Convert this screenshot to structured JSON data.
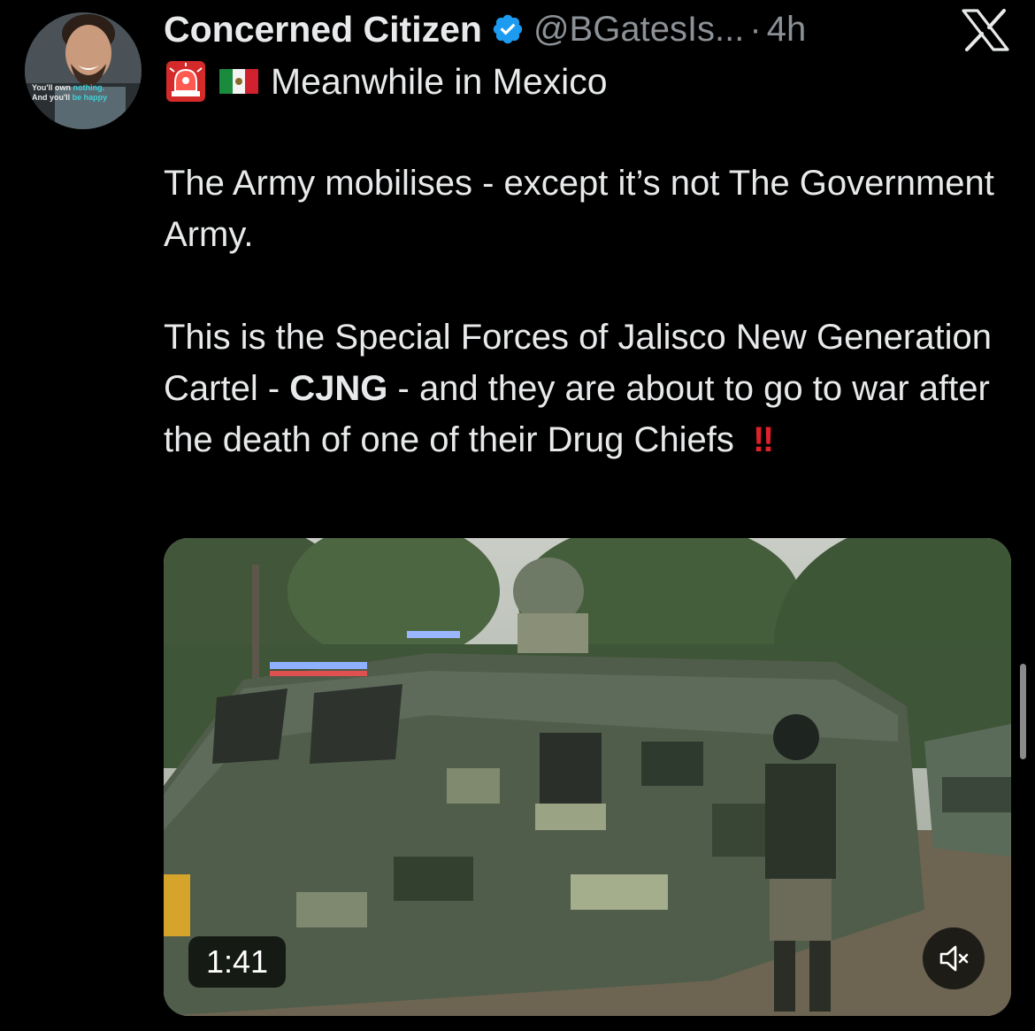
{
  "author": {
    "display_name": "Concerned Citizen",
    "handle": "@BGatesIs...",
    "separator": "·",
    "timestamp": "4h",
    "verified": true,
    "avatar": {
      "line1_a": "You'll own ",
      "line1_b": "nothing.",
      "line2_a": "And you'll ",
      "line2_b": "be happy",
      "accent_color": "#3fd2d9"
    }
  },
  "icons": {
    "verified": "verified-badge-icon",
    "platform_logo": "x-logo-icon",
    "siren": "rotating-light-icon",
    "flag": "mexico-flag-icon",
    "mute": "speaker-muted-icon",
    "exclamation": "double-exclamation-icon"
  },
  "tweet": {
    "headline": "Meanwhile in Mexico",
    "paragraph1": "The Army mobilises - except it’s not The Government Army.",
    "paragraph2_before": "This is the Special Forces of Jalisco New Generation Cartel - ",
    "paragraph2_bold": "CJNG",
    "paragraph2_after": " - and they are about to go to war after the death of one of their Drug Chiefs ",
    "emphasis": "‼"
  },
  "video": {
    "duration": "1:41",
    "muted": true
  },
  "colors": {
    "background": "#000000",
    "text": "#e7e9ea",
    "secondary_text": "#8b9196",
    "verified_blue": "#1d9bf0",
    "emphasis_red": "#e0202a"
  }
}
